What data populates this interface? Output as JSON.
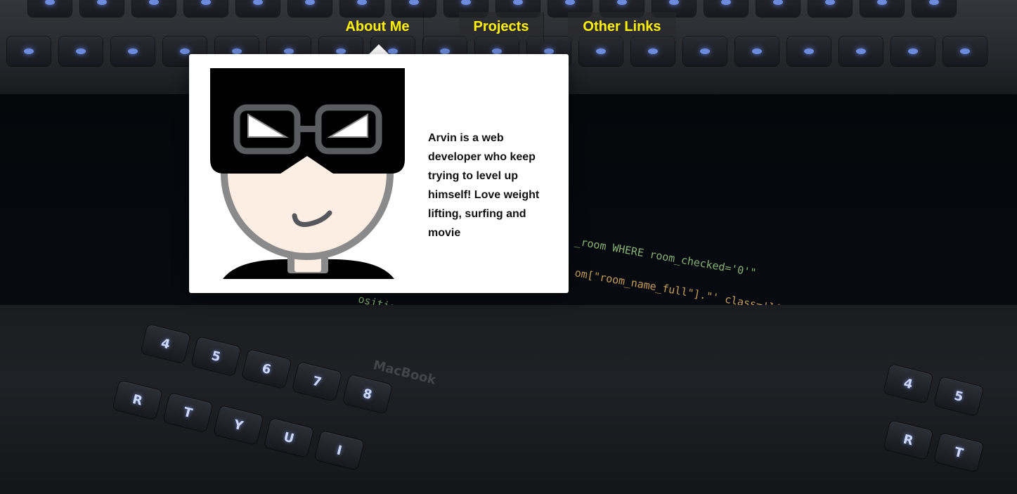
{
  "nav": {
    "items": [
      {
        "label": "About Me",
        "active": true
      },
      {
        "label": "Projects",
        "active": false
      },
      {
        "label": "Other Links",
        "active": false
      }
    ]
  },
  "about": {
    "bio": "Arvin is a web developer who keep trying to level up himself! Love weight lifting, surfing and movie"
  },
  "background": {
    "code_lines": [
      "_room WHERE room_checked='0'\"",
      "om[\"room_name_full\"].\"' class='list-grou",
      "osition on tbl_disposition.disposition_user = u.user_ID"
    ],
    "brand": "MacBook",
    "side_text": "st-grou"
  },
  "colors": {
    "nav_text": "#fff200",
    "card_bg": "#ffffff",
    "bio_text": "#111111"
  },
  "icons": {
    "avatar": "cartoon-avatar-with-glasses"
  }
}
